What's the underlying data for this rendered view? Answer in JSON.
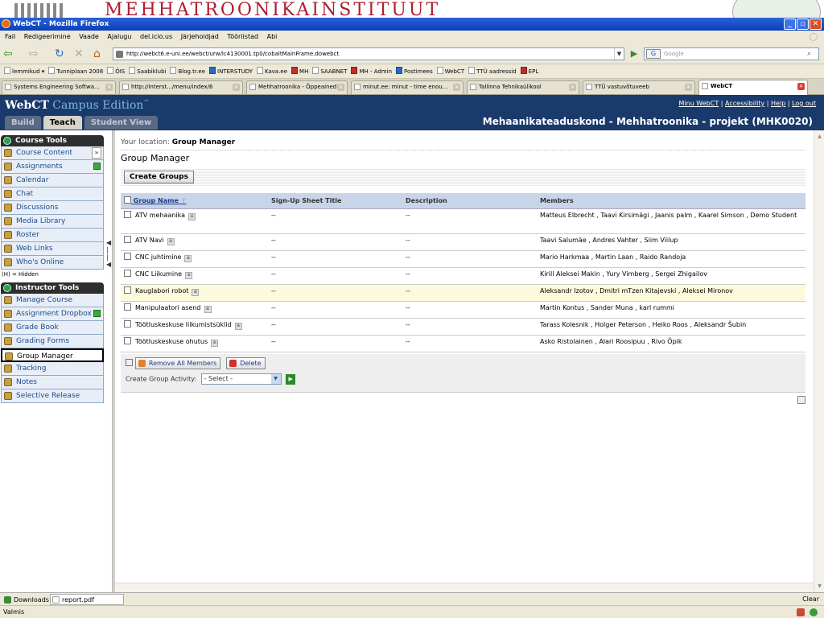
{
  "desktop": {
    "banner_text": "MEHHATROONIKAINSTITUUT"
  },
  "window": {
    "title": "WebCT - Mozilla Firefox"
  },
  "menu": [
    "Fail",
    "Redigeerimine",
    "Vaade",
    "Ajalugu",
    "del.icio.us",
    "Järjehoidjad",
    "Tööriistad",
    "Abi"
  ],
  "nav": {
    "back": "⇦",
    "forward": "⇨",
    "reload": "↻",
    "stop": "✕",
    "home": "⌂",
    "url": "http://webct6.e-uni.ee/webct/urw/lc4130001.tp0/cobaltMainFrame.dowebct",
    "search_engine": "G",
    "search_placeholder": "Google"
  },
  "bookmarks": [
    "lemmikud ▾",
    "Tunniplaan 2008",
    "ÕIS",
    "Saabiklubi",
    "Blog.tr.ee",
    "INTERSTUDY",
    "Kava.ee",
    "MH",
    "SAABNET",
    "MH - Admin",
    "Postimees",
    "WebCT",
    "TTÜ aadressid",
    "EPL"
  ],
  "browser_tabs": [
    {
      "label": "Systems Engineering Softwa...",
      "active": false
    },
    {
      "label": "http://interst.../menu/index/6",
      "active": false
    },
    {
      "label": "Mehhatroonika - Õppeained",
      "active": false
    },
    {
      "label": "minut.ee: minut - time enou...",
      "active": false
    },
    {
      "label": "Tallinna Tehnikaülikool",
      "active": false
    },
    {
      "label": "TTÜ vastuvõtuveeb",
      "active": false
    },
    {
      "label": "WebCT",
      "active": true
    }
  ],
  "header": {
    "logo_main": "WebCT",
    "logo_sub": " Campus Edition",
    "logo_tm": "™",
    "links": [
      "Minu WebCT",
      "Accessibility",
      "Help",
      "Log out"
    ],
    "separator": " | ",
    "mode_tabs": [
      "Build",
      "Teach",
      "Student View"
    ],
    "active_mode": "Teach",
    "course_title": "Mehaanikateaduskond - Mehhatroonika - projekt (MHK0020)"
  },
  "sidebar": {
    "course_tools_title": "Course Tools",
    "course_tools": [
      "Course Content",
      "Assignments",
      "Calendar",
      "Chat",
      "Discussions",
      "Media Library",
      "Roster",
      "Web Links",
      "Who's Online"
    ],
    "hidden_note": "(H) = Hidden",
    "instructor_tools_title": "Instructor Tools",
    "instructor_tools": [
      "Manage Course",
      "Assignment Dropbox",
      "Grade Book",
      "Grading Forms",
      "Group Manager",
      "Tracking",
      "Notes",
      "Selective Release"
    ],
    "selected": "Group Manager"
  },
  "main": {
    "location_label": "Your location: ",
    "location_value": "Group Manager",
    "page_title": "Group Manager",
    "create_groups": "Create Groups",
    "columns": [
      "Group Name",
      "Sign-Up Sheet Title",
      "Description",
      "Members"
    ],
    "sort_glyph": "⇧",
    "rows": [
      {
        "name": "ATV mehaanika",
        "signup": "--",
        "desc": "--",
        "members": "Matteus Elbrecht , Taavi Kirsimägi , Jaanis palm , Kaarel Simson , Demo Student",
        "highlight": false
      },
      {
        "name": "ATV Navi",
        "signup": "--",
        "desc": "--",
        "members": "Taavi Salumäe , Andres Vahter , Siim Viilup",
        "highlight": false
      },
      {
        "name": "CNC juhtimine",
        "signup": "--",
        "desc": "--",
        "members": "Mario Harkmaa , Martin Laan , Raido Randoja",
        "highlight": false
      },
      {
        "name": "CNC Liikumine",
        "signup": "--",
        "desc": "--",
        "members": "Kirill Aleksei Makin , Yury Vimberg , Sergei Zhigailov",
        "highlight": false
      },
      {
        "name": "Kauglabori robot",
        "signup": "--",
        "desc": "--",
        "members": "Aleksandr Izotov , Dmitri mTzen Kitajevski , Aleksei Mironov",
        "highlight": true
      },
      {
        "name": "Manipulaatori asend",
        "signup": "--",
        "desc": "--",
        "members": "Martin Kontus , Sander Muna , karl rummi",
        "highlight": false
      },
      {
        "name": "Töötluskeskuse liikumistsüklid",
        "signup": "--",
        "desc": "--",
        "members": "Tarass Kolesnik , Holger Peterson , Heiko Roos , Aleksandr Šubin",
        "highlight": false
      },
      {
        "name": "Töötluskeskuse ohutus",
        "signup": "--",
        "desc": "--",
        "members": "Asko Ristolainen , Alari Roosipuu , Rivo Õpik",
        "highlight": false
      }
    ],
    "remove_all": "Remove All Members",
    "delete": "Delete",
    "activity_label": "Create Group Activity:",
    "activity_select": "- Select -"
  },
  "downloads": {
    "label": "Downloads",
    "file": "report.pdf",
    "clear": "Clear"
  },
  "status": {
    "text": "Valmis"
  }
}
